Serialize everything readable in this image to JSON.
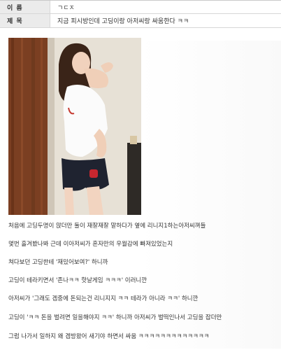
{
  "header": {
    "name_label": "이 름",
    "name_value": "ㄱㄷㅈ",
    "subject_label": "제 목",
    "subject_value": "지금 피시방인데 고딩이랑 아저씨랑 싸움한다 ㅋㅋ"
  },
  "image": {
    "icon": "photo-of-woman"
  },
  "body": {
    "lines": [
      "처음에 고딩두명이 앉더만 둘이 재잘재잘 말하다가 옆에 리니지1하는아저씨껴들",
      "몇번 흘겨봤나봐 근데 이아저씨가 혼자만의 우월감에 빠져있었는지",
      "쳐다보던 고딩한테 '재밌어보여?' 하니까",
      "고딩이 테라키면서 '존나ㅋㅋ 핫날게임 ㅋㅋㅋ' 이러니깐",
      "아저씨가 '그래도 겜중에 돈되는건 리니지지 ㅋㅋ 테라가 아니라 ㅋㅋ' 하니깐",
      "고딩이 'ㅋㅋ 돈을 벌려면 일을해야지 ㅋㅋ' 하니까 아저씨가 벌떡인나서 고딩을 잡더만",
      "그럼 나가서 일하지 왜 겜방왔어 새기야 하면서 싸움 ㅋㅋㅋㅋㅋㅋㅋㅋㅋㅋㅋㅋㅋ"
    ]
  }
}
